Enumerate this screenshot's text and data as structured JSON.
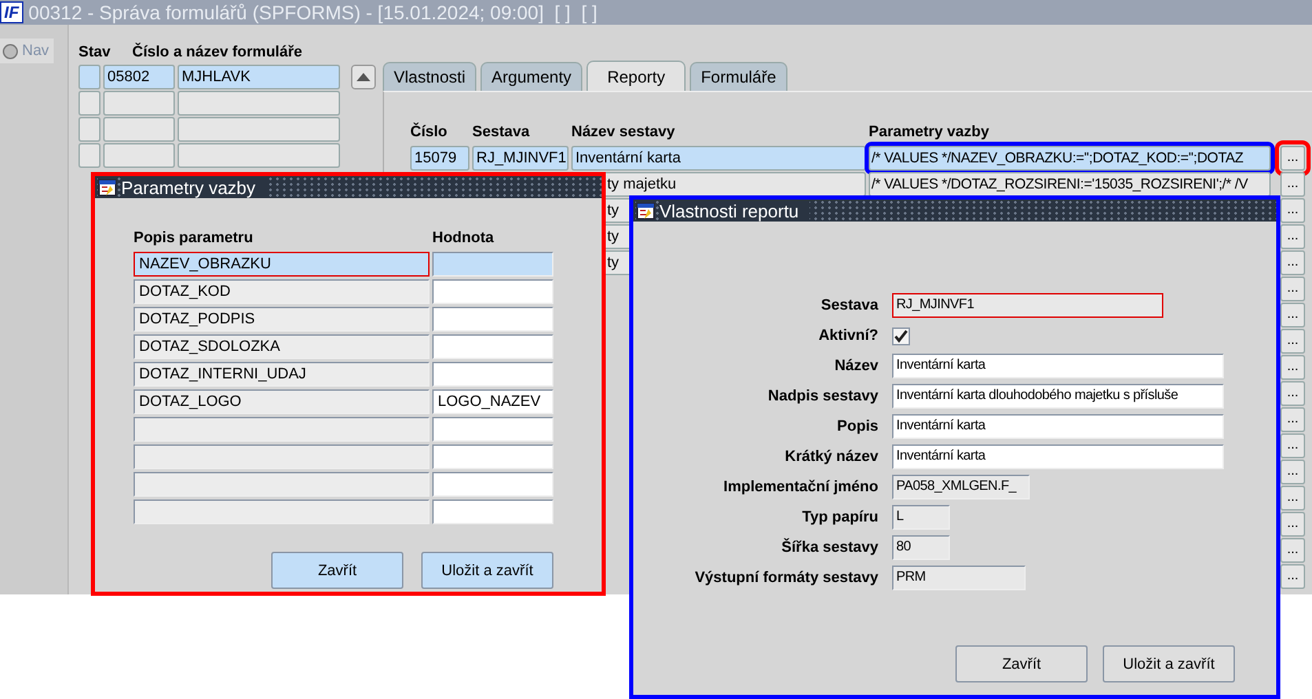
{
  "window": {
    "logo": "IF",
    "title": "00312 - Správa formulářů (SPFORMS) - [15.01.2024; 09:00]  [ ]  [ ]"
  },
  "nav": {
    "label": "Nav",
    "selected": false
  },
  "forms": {
    "columns": [
      "Stav",
      "Číslo a název formuláře"
    ],
    "rows": [
      {
        "number": "05802",
        "name": "MJHLAVK",
        "selected": true
      },
      {
        "selected": false
      },
      {
        "selected": false
      },
      {
        "selected": false
      }
    ]
  },
  "tabs": [
    {
      "label": "Vlastnosti",
      "selected": false
    },
    {
      "label": "Argumenty",
      "selected": false
    },
    {
      "label": "Reporty",
      "selected": true
    },
    {
      "label": "Formuláře",
      "selected": false
    }
  ],
  "reports": {
    "columns": [
      "Číslo",
      "Sestava",
      "Název sestavy",
      "Parametry vazby"
    ],
    "rows": [
      {
        "number": "15079",
        "report": "RJ_MJINVF1",
        "name": "Inventární karta",
        "params": "/* VALUES */NAZEV_OBRAZKU:='';DOTAZ_KOD:='';DOTAZ",
        "selected": true,
        "cut_left": false,
        "button": "..."
      },
      {
        "name": "ty majetku",
        "params": "/* VALUES */DOTAZ_ROZSIRENI:='15035_ROZSIRENI';/* /V",
        "selected": false,
        "cut_left": true,
        "button": "..."
      },
      {
        "name": "ty",
        "selected": false,
        "cut_left": true,
        "button": "..."
      },
      {
        "name": "ty",
        "selected": false,
        "cut_left": true,
        "button": "..."
      },
      {
        "name": "ty",
        "selected": false,
        "cut_left": true,
        "button": "..."
      },
      {
        "button": "..."
      },
      {
        "button": "..."
      },
      {
        "button": "..."
      },
      {
        "button": "..."
      },
      {
        "button": "..."
      },
      {
        "button": "..."
      },
      {
        "button": "..."
      },
      {
        "button": "..."
      },
      {
        "button": "..."
      },
      {
        "button": "..."
      },
      {
        "button": "..."
      },
      {
        "button": "..."
      }
    ]
  },
  "param_dialog": {
    "title": "Parametry vazby",
    "columns": [
      "Popis parametru",
      "Hodnota"
    ],
    "rows": [
      {
        "name": "NAZEV_OBRAZKU",
        "selected": true
      },
      {
        "name": "DOTAZ_KOD",
        "selected": false
      },
      {
        "name": "DOTAZ_PODPIS",
        "selected": false
      },
      {
        "name": "DOTAZ_SDOLOZKA",
        "selected": false
      },
      {
        "name": "DOTAZ_INTERNI_UDAJ",
        "selected": false
      },
      {
        "name": "DOTAZ_LOGO",
        "value": "LOGO_NAZEV",
        "selected": false
      },
      {
        "selected": false
      },
      {
        "selected": false
      },
      {
        "selected": false
      },
      {
        "selected": false
      }
    ],
    "buttons": [
      "Zavřít",
      "Uložit a zavřít"
    ]
  },
  "report_dialog": {
    "title": "Vlastnosti reportu",
    "fields": [
      {
        "kind": "field",
        "label": "Sestava",
        "value": "RJ_MJINVF1",
        "readonly": true,
        "focused": true
      },
      {
        "kind": "checkbox",
        "label": "Aktivní?",
        "checked": true
      },
      {
        "kind": "field",
        "label": "Název",
        "value": "Inventární karta",
        "readonly": false,
        "focused": false
      },
      {
        "kind": "field",
        "label": "Nadpis sestavy",
        "value": "Inventární karta dlouhodobého majetku s přísluše",
        "readonly": false,
        "focused": false
      },
      {
        "kind": "field",
        "label": "Popis",
        "value": "Inventární karta",
        "readonly": false,
        "focused": false
      },
      {
        "kind": "field",
        "label": "Krátký název",
        "value": "Inventární karta",
        "readonly": false,
        "focused": false
      },
      {
        "kind": "field",
        "label": "Implementační jméno",
        "value": "PA058_XMLGEN.F_",
        "readonly": true,
        "focused": false
      },
      {
        "kind": "field",
        "label": "Typ papíru",
        "value": "L",
        "readonly": true,
        "focused": false
      },
      {
        "kind": "field",
        "label": "Šířka sestavy",
        "value": "80",
        "readonly": true,
        "focused": false
      },
      {
        "kind": "field",
        "label": "Výstupní formáty sestavy",
        "value": "PRM",
        "readonly": true,
        "focused": false
      }
    ],
    "buttons": [
      "Zavřít",
      "Uložit a zavřít"
    ]
  }
}
